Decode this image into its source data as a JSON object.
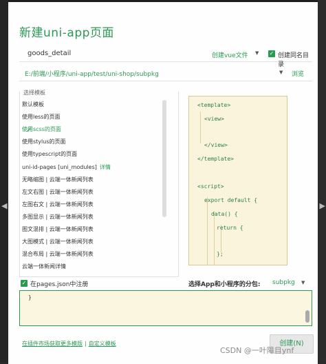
{
  "dialog": {
    "title": "新建uni-app页面",
    "page_name": "goods_detail",
    "file_type": "创建vue文件",
    "same_dir_label": "创建同名目录",
    "path": "E:/前端/小程序/uni-app/test/uni-shop/subpkg",
    "browse": "浏览"
  },
  "templates": {
    "label": "选择模板",
    "items": [
      {
        "label": "默认模板"
      },
      {
        "label": "使用less的页面"
      },
      {
        "label": "使用scss的页面"
      },
      {
        "label": "使用stylus的页面"
      },
      {
        "label": "使用typescript的页面"
      },
      {
        "label": "uni-id-pages [uni_modules]",
        "link": "详情"
      },
      {
        "label": "无略缩图 | 云端一体新闻列表"
      },
      {
        "label": "左文右图 | 云端一体新闻列表"
      },
      {
        "label": "左图右文 | 云端一体新闻列表"
      },
      {
        "label": "多图显示 | 云端一体新闻列表"
      },
      {
        "label": "图文混排 | 云端一体新闻列表"
      },
      {
        "label": "大图模式 | 云端一体新闻列表"
      },
      {
        "label": "混合布局 | 云端一体新闻列表"
      },
      {
        "label": "云端一体新闻详情"
      }
    ],
    "selected": "使用scss的页面"
  },
  "preview": {
    "lines": [
      "<template>",
      "<view>",
      "",
      "</view>",
      "</template>",
      "",
      "<script>",
      "export default {",
      "data() {",
      "return {",
      "",
      "};"
    ]
  },
  "pages_json": {
    "label": "在pages.json中注册",
    "subpackage_label": "选择App和小程序的分包:",
    "subpackage_value": "subpkg",
    "content": "}"
  },
  "footer": {
    "link_more": "在插件市场获取更多模版",
    "link_custom": "自定义模板",
    "create": "创建(N)"
  },
  "watermark": "CSDN @一叶障目ynf",
  "colors": {
    "accent": "#2b9a53",
    "code_bg": "#faf4dc"
  }
}
